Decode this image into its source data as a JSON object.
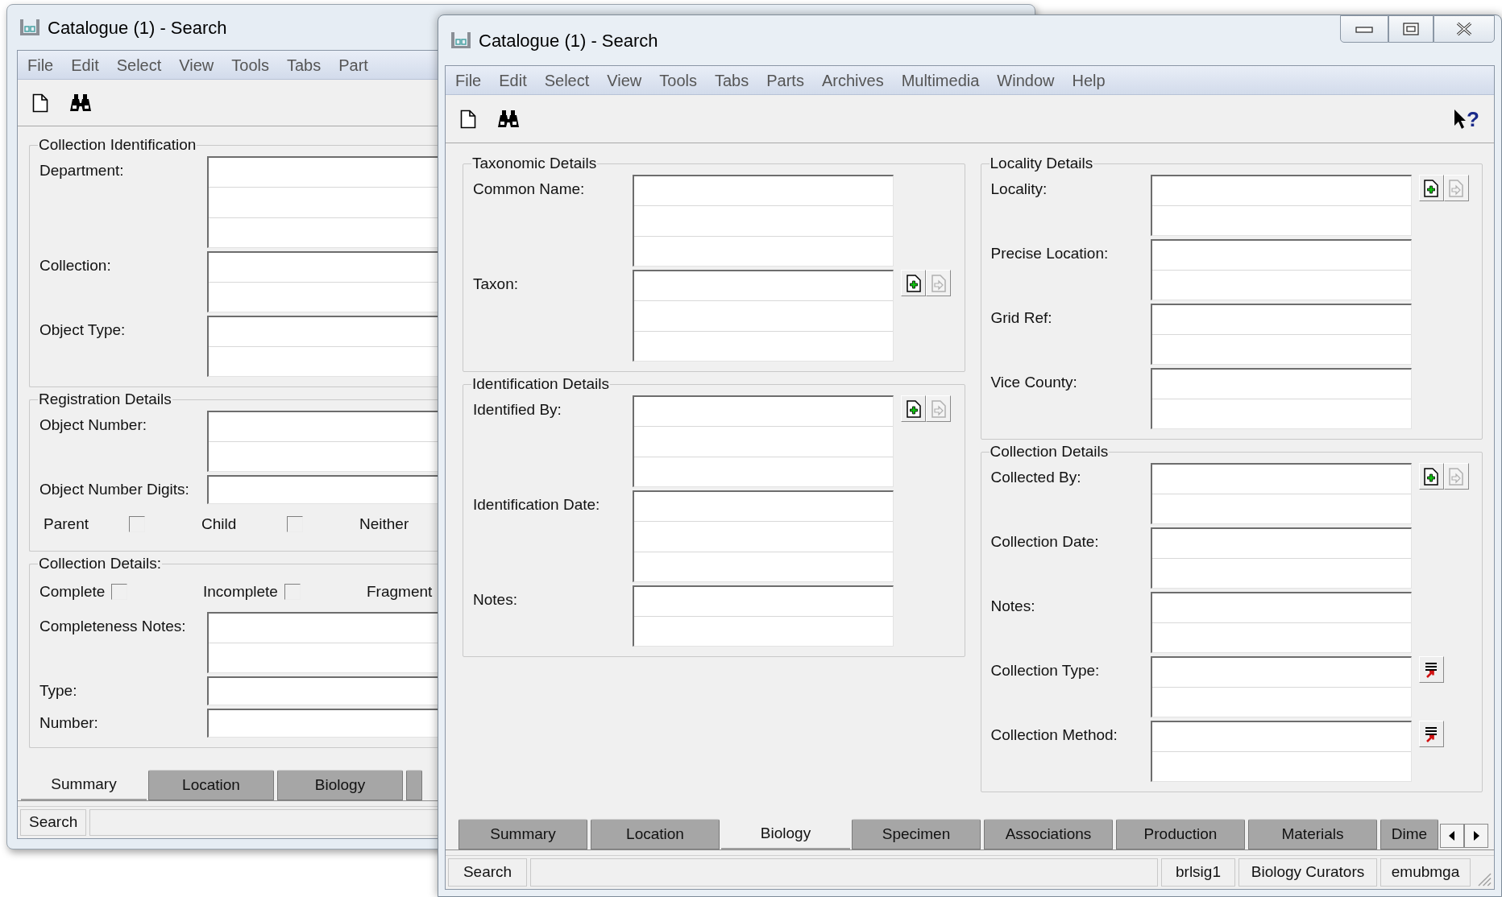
{
  "back_window": {
    "title": "Catalogue (1) - Search",
    "menu": [
      "File",
      "Edit",
      "Select",
      "View",
      "Tools",
      "Tabs",
      "Part"
    ],
    "groups": [
      {
        "title": "Collection Identification",
        "rows": [
          {
            "kind": "tall_field",
            "label": "Department:"
          },
          {
            "kind": "field",
            "label": "Collection:"
          },
          {
            "kind": "field",
            "label": "Object Type:"
          }
        ]
      },
      {
        "title": "Registration Details",
        "rows": [
          {
            "kind": "field",
            "label": "Object Number:"
          },
          {
            "kind": "line_field",
            "label": "Object Number Digits:"
          },
          {
            "kind": "checks",
            "items": [
              {
                "label": "Parent",
                "checked": false
              },
              {
                "label": "Child",
                "checked": false
              },
              {
                "label": "Neither"
              }
            ]
          }
        ]
      },
      {
        "title": "Collection Details:",
        "rows": [
          {
            "kind": "inline_checks",
            "items": [
              {
                "label": "Complete",
                "checked": false
              },
              {
                "label": "Incomplete",
                "checked": false
              },
              {
                "label": "Fragment"
              }
            ]
          },
          {
            "kind": "field",
            "label": "Completeness Notes:"
          },
          {
            "kind": "line_field",
            "label": "Type:"
          },
          {
            "kind": "line_field",
            "label": "Number:"
          }
        ]
      }
    ],
    "tabs": [
      {
        "label": "Summary",
        "selected": true
      },
      {
        "label": "Location",
        "selected": false
      },
      {
        "label": "Biology",
        "selected": false
      },
      {
        "selected": false
      }
    ],
    "status": [
      "Search"
    ]
  },
  "front_window": {
    "title": "Catalogue (1) - Search",
    "menu": [
      "File",
      "Edit",
      "Select",
      "View",
      "Tools",
      "Tabs",
      "Parts",
      "Archives",
      "Multimedia",
      "Window",
      "Help"
    ],
    "help_glyph": "?",
    "columns": [
      [
        {
          "title": "Taxonomic Details",
          "rows": [
            {
              "kind": "tall_field",
              "label": "Common Name:"
            },
            {
              "kind": "tall_field",
              "label": "Taxon:",
              "buttons": [
                {
                  "kind": "add",
                  "disabled": false
                },
                {
                  "kind": "attach",
                  "disabled": true
                }
              ]
            }
          ]
        },
        {
          "title": "Identification Details",
          "rows": [
            {
              "kind": "tall_field",
              "label": "Identified By:",
              "buttons": [
                {
                  "kind": "add",
                  "disabled": false
                },
                {
                  "kind": "attach",
                  "disabled": true
                }
              ]
            },
            {
              "kind": "tall_field",
              "label": "Identification Date:"
            },
            {
              "kind": "field",
              "label": "Notes:"
            }
          ]
        }
      ],
      [
        {
          "title": "Locality Details",
          "rows": [
            {
              "kind": "field",
              "label": "Locality:",
              "buttons": [
                {
                  "kind": "add",
                  "disabled": false
                },
                {
                  "kind": "attach",
                  "disabled": true
                }
              ]
            },
            {
              "kind": "field",
              "label": "Precise Location:"
            },
            {
              "kind": "field",
              "label": "Grid Ref:"
            },
            {
              "kind": "field",
              "label": "Vice County:"
            }
          ]
        },
        {
          "title": "Collection Details",
          "rows": [
            {
              "kind": "field",
              "label": "Collected By:",
              "buttons": [
                {
                  "kind": "add",
                  "disabled": false
                },
                {
                  "kind": "attach",
                  "disabled": true
                }
              ]
            },
            {
              "kind": "field",
              "label": "Collection Date:"
            },
            {
              "kind": "field",
              "label": "Notes:"
            },
            {
              "kind": "field",
              "label": "Collection Type:",
              "buttons": [
                {
                  "kind": "lookup",
                  "disabled": false
                }
              ]
            },
            {
              "kind": "field",
              "label": "Collection Method:",
              "buttons": [
                {
                  "kind": "lookup",
                  "disabled": false
                }
              ]
            }
          ]
        }
      ]
    ],
    "tabs": [
      {
        "label": "Summary",
        "selected": false
      },
      {
        "label": "Location",
        "selected": false
      },
      {
        "label": "Biology",
        "selected": true
      },
      {
        "label": "Specimen",
        "selected": false
      },
      {
        "label": "Associations",
        "selected": false
      },
      {
        "label": "Production",
        "selected": false
      },
      {
        "label": "Materials",
        "selected": false
      },
      {
        "label": "Dime",
        "selected": false
      }
    ],
    "status": [
      "Search",
      "brlsig1",
      "Biology Curators",
      "emubmga"
    ]
  }
}
